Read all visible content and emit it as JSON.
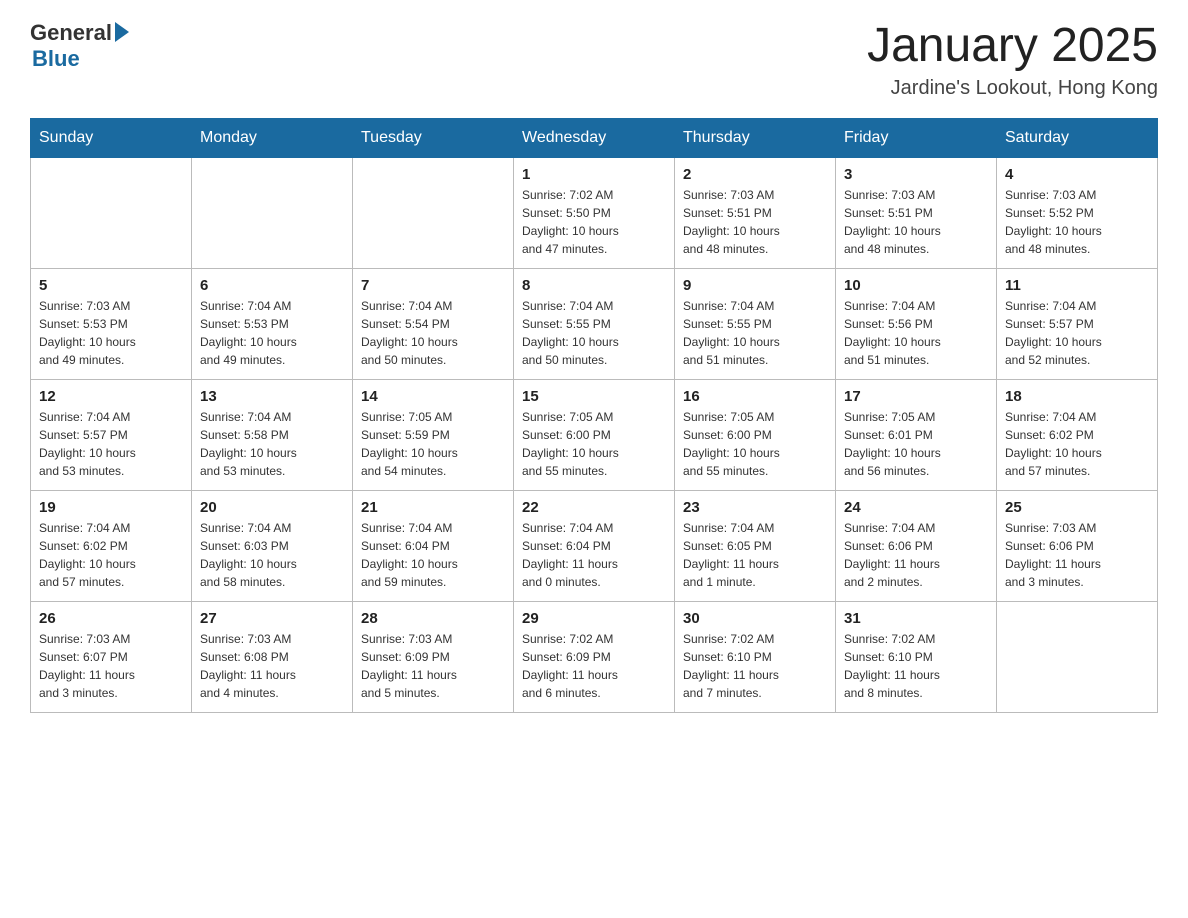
{
  "header": {
    "logo_general": "General",
    "logo_blue": "Blue",
    "month_year": "January 2025",
    "location": "Jardine's Lookout, Hong Kong"
  },
  "days_of_week": [
    "Sunday",
    "Monday",
    "Tuesday",
    "Wednesday",
    "Thursday",
    "Friday",
    "Saturday"
  ],
  "weeks": [
    [
      {
        "day": "",
        "info": ""
      },
      {
        "day": "",
        "info": ""
      },
      {
        "day": "",
        "info": ""
      },
      {
        "day": "1",
        "info": "Sunrise: 7:02 AM\nSunset: 5:50 PM\nDaylight: 10 hours\nand 47 minutes."
      },
      {
        "day": "2",
        "info": "Sunrise: 7:03 AM\nSunset: 5:51 PM\nDaylight: 10 hours\nand 48 minutes."
      },
      {
        "day": "3",
        "info": "Sunrise: 7:03 AM\nSunset: 5:51 PM\nDaylight: 10 hours\nand 48 minutes."
      },
      {
        "day": "4",
        "info": "Sunrise: 7:03 AM\nSunset: 5:52 PM\nDaylight: 10 hours\nand 48 minutes."
      }
    ],
    [
      {
        "day": "5",
        "info": "Sunrise: 7:03 AM\nSunset: 5:53 PM\nDaylight: 10 hours\nand 49 minutes."
      },
      {
        "day": "6",
        "info": "Sunrise: 7:04 AM\nSunset: 5:53 PM\nDaylight: 10 hours\nand 49 minutes."
      },
      {
        "day": "7",
        "info": "Sunrise: 7:04 AM\nSunset: 5:54 PM\nDaylight: 10 hours\nand 50 minutes."
      },
      {
        "day": "8",
        "info": "Sunrise: 7:04 AM\nSunset: 5:55 PM\nDaylight: 10 hours\nand 50 minutes."
      },
      {
        "day": "9",
        "info": "Sunrise: 7:04 AM\nSunset: 5:55 PM\nDaylight: 10 hours\nand 51 minutes."
      },
      {
        "day": "10",
        "info": "Sunrise: 7:04 AM\nSunset: 5:56 PM\nDaylight: 10 hours\nand 51 minutes."
      },
      {
        "day": "11",
        "info": "Sunrise: 7:04 AM\nSunset: 5:57 PM\nDaylight: 10 hours\nand 52 minutes."
      }
    ],
    [
      {
        "day": "12",
        "info": "Sunrise: 7:04 AM\nSunset: 5:57 PM\nDaylight: 10 hours\nand 53 minutes."
      },
      {
        "day": "13",
        "info": "Sunrise: 7:04 AM\nSunset: 5:58 PM\nDaylight: 10 hours\nand 53 minutes."
      },
      {
        "day": "14",
        "info": "Sunrise: 7:05 AM\nSunset: 5:59 PM\nDaylight: 10 hours\nand 54 minutes."
      },
      {
        "day": "15",
        "info": "Sunrise: 7:05 AM\nSunset: 6:00 PM\nDaylight: 10 hours\nand 55 minutes."
      },
      {
        "day": "16",
        "info": "Sunrise: 7:05 AM\nSunset: 6:00 PM\nDaylight: 10 hours\nand 55 minutes."
      },
      {
        "day": "17",
        "info": "Sunrise: 7:05 AM\nSunset: 6:01 PM\nDaylight: 10 hours\nand 56 minutes."
      },
      {
        "day": "18",
        "info": "Sunrise: 7:04 AM\nSunset: 6:02 PM\nDaylight: 10 hours\nand 57 minutes."
      }
    ],
    [
      {
        "day": "19",
        "info": "Sunrise: 7:04 AM\nSunset: 6:02 PM\nDaylight: 10 hours\nand 57 minutes."
      },
      {
        "day": "20",
        "info": "Sunrise: 7:04 AM\nSunset: 6:03 PM\nDaylight: 10 hours\nand 58 minutes."
      },
      {
        "day": "21",
        "info": "Sunrise: 7:04 AM\nSunset: 6:04 PM\nDaylight: 10 hours\nand 59 minutes."
      },
      {
        "day": "22",
        "info": "Sunrise: 7:04 AM\nSunset: 6:04 PM\nDaylight: 11 hours\nand 0 minutes."
      },
      {
        "day": "23",
        "info": "Sunrise: 7:04 AM\nSunset: 6:05 PM\nDaylight: 11 hours\nand 1 minute."
      },
      {
        "day": "24",
        "info": "Sunrise: 7:04 AM\nSunset: 6:06 PM\nDaylight: 11 hours\nand 2 minutes."
      },
      {
        "day": "25",
        "info": "Sunrise: 7:03 AM\nSunset: 6:06 PM\nDaylight: 11 hours\nand 3 minutes."
      }
    ],
    [
      {
        "day": "26",
        "info": "Sunrise: 7:03 AM\nSunset: 6:07 PM\nDaylight: 11 hours\nand 3 minutes."
      },
      {
        "day": "27",
        "info": "Sunrise: 7:03 AM\nSunset: 6:08 PM\nDaylight: 11 hours\nand 4 minutes."
      },
      {
        "day": "28",
        "info": "Sunrise: 7:03 AM\nSunset: 6:09 PM\nDaylight: 11 hours\nand 5 minutes."
      },
      {
        "day": "29",
        "info": "Sunrise: 7:02 AM\nSunset: 6:09 PM\nDaylight: 11 hours\nand 6 minutes."
      },
      {
        "day": "30",
        "info": "Sunrise: 7:02 AM\nSunset: 6:10 PM\nDaylight: 11 hours\nand 7 minutes."
      },
      {
        "day": "31",
        "info": "Sunrise: 7:02 AM\nSunset: 6:10 PM\nDaylight: 11 hours\nand 8 minutes."
      },
      {
        "day": "",
        "info": ""
      }
    ]
  ]
}
